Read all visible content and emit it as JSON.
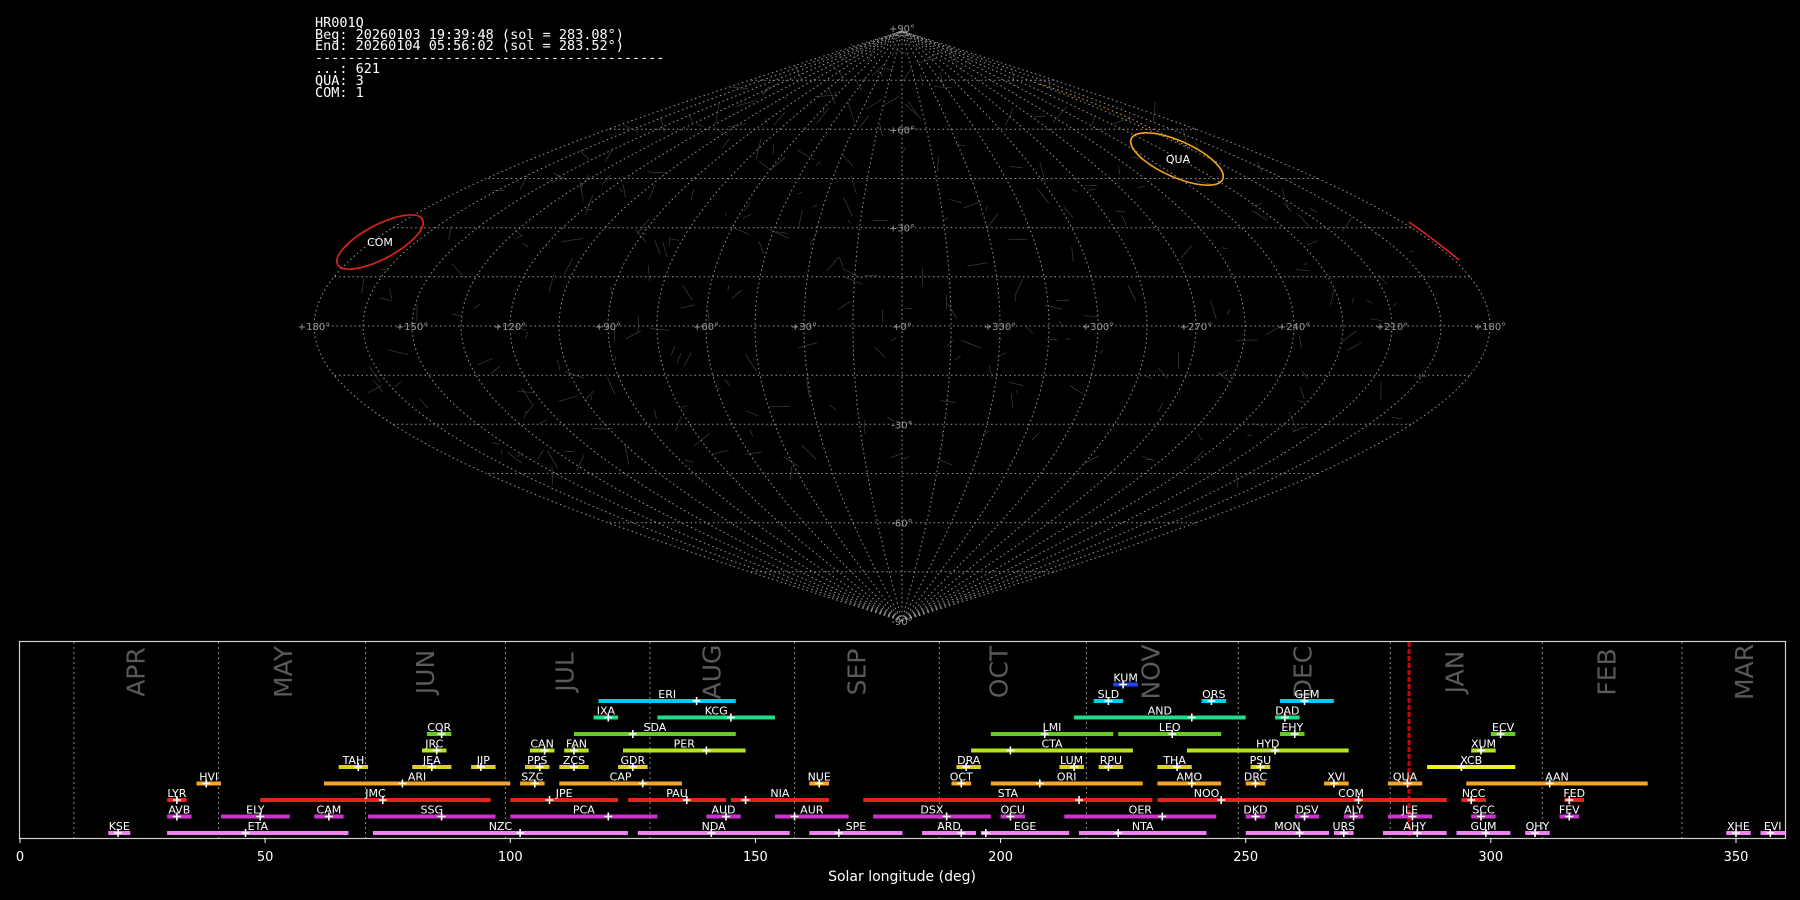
{
  "info": {
    "station": "HR001Q",
    "beg": "Beg: 20260103 19:39:48 (sol = 283.08°)",
    "end": "End: 20260104 05:56:02 (sol = 283.52°)",
    "separator": "-------------------------------------------",
    "counts": [
      "...: 621",
      "QUA: 3",
      "COM: 1"
    ]
  },
  "sky_map": {
    "projection": "sinusoidal",
    "lon_ticks": [
      "+180°",
      "+150°",
      "+120°",
      "+90°",
      "+60°",
      "+30°",
      "+0°",
      "+330°",
      "+300°",
      "+270°",
      "+240°",
      "+210°",
      "+180°"
    ],
    "lat_ticks": [
      "+90°",
      "+60°",
      "+30°",
      "-30°",
      "-60°",
      "-90°"
    ],
    "radiant_circles": [
      {
        "code": "QUA",
        "color": "#f5a623"
      },
      {
        "code": "COM",
        "color": "#e3241b"
      }
    ]
  },
  "chart_data": {
    "type": "timeline",
    "xlabel": "Solar longitude (deg)",
    "xlim": [
      0,
      360
    ],
    "x_ticks": [
      0,
      50,
      100,
      150,
      200,
      250,
      300,
      350
    ],
    "current_sol": 283.3,
    "months": [
      {
        "name": "APR",
        "start": 11,
        "mid": 24
      },
      {
        "name": "MAY",
        "start": 40.5,
        "mid": 54
      },
      {
        "name": "JUN",
        "start": 70.5,
        "mid": 83
      },
      {
        "name": "JUL",
        "start": 99,
        "mid": 111.5
      },
      {
        "name": "AUG",
        "start": 128.5,
        "mid": 141.5
      },
      {
        "name": "SEP",
        "start": 158,
        "mid": 171
      },
      {
        "name": "OCT",
        "start": 187.5,
        "mid": 200
      },
      {
        "name": "NOV",
        "start": 217.5,
        "mid": 231
      },
      {
        "name": "DEC",
        "start": 248.5,
        "mid": 262
      },
      {
        "name": "JAN",
        "start": 279.5,
        "mid": 293
      },
      {
        "name": "FEB",
        "start": 310.5,
        "mid": 324
      },
      {
        "name": "MAR",
        "start": 339,
        "mid": 352
      }
    ],
    "showers": [
      {
        "code": "KSE",
        "start": 18,
        "end": 22.5,
        "peak": 20,
        "row": 0,
        "color": "#ee82ee"
      },
      {
        "code": "ETA",
        "start": 30,
        "end": 67,
        "peak": 46,
        "row": 0,
        "color": "#ee82ee"
      },
      {
        "code": "NZC",
        "start": 72,
        "end": 124,
        "peak": 102,
        "row": 0,
        "color": "#ee82ee"
      },
      {
        "code": "NDA",
        "start": 126,
        "end": 157,
        "peak": 141,
        "row": 0,
        "color": "#ee82ee"
      },
      {
        "code": "SPE",
        "start": 161,
        "end": 180,
        "peak": 167,
        "row": 0,
        "color": "#ee82ee"
      },
      {
        "code": "ARD",
        "start": 184,
        "end": 195,
        "peak": 192,
        "row": 0,
        "color": "#ee82ee"
      },
      {
        "code": "EGE",
        "start": 196,
        "end": 214,
        "peak": 197,
        "row": 0,
        "color": "#ee82ee"
      },
      {
        "code": "NTA",
        "start": 216,
        "end": 242,
        "peak": 224,
        "row": 0,
        "color": "#ee82ee"
      },
      {
        "code": "MON",
        "start": 250,
        "end": 267,
        "peak": 261,
        "row": 0,
        "color": "#ee82ee"
      },
      {
        "code": "URS",
        "start": 268,
        "end": 272,
        "peak": 270,
        "row": 0,
        "color": "#ee82ee"
      },
      {
        "code": "AHY",
        "start": 278,
        "end": 291,
        "peak": 285,
        "row": 0,
        "color": "#ee82ee"
      },
      {
        "code": "GUM",
        "start": 293,
        "end": 304,
        "peak": 299,
        "row": 0,
        "color": "#ee82ee"
      },
      {
        "code": "OHY",
        "start": 307,
        "end": 312,
        "peak": 309,
        "row": 0,
        "color": "#ee82ee"
      },
      {
        "code": "XHE",
        "start": 348,
        "end": 353,
        "peak": 350,
        "row": 0,
        "color": "#ee82ee"
      },
      {
        "code": "EVI",
        "start": 355,
        "end": 360,
        "peak": 357,
        "row": 0,
        "color": "#ee82ee"
      },
      {
        "code": "AVB",
        "start": 30,
        "end": 35,
        "peak": 32,
        "row": 1,
        "color": "#cc33cc"
      },
      {
        "code": "ELY",
        "start": 41,
        "end": 55,
        "peak": 49,
        "row": 1,
        "color": "#cc33cc"
      },
      {
        "code": "CAM",
        "start": 60,
        "end": 66,
        "peak": 63,
        "row": 1,
        "color": "#cc33cc"
      },
      {
        "code": "SSG",
        "start": 71,
        "end": 97,
        "peak": 86,
        "row": 1,
        "color": "#cc33cc"
      },
      {
        "code": "PCA",
        "start": 100,
        "end": 130,
        "peak": 120,
        "row": 1,
        "color": "#cc33cc"
      },
      {
        "code": "AUD",
        "start": 140,
        "end": 147,
        "peak": 144,
        "row": 1,
        "color": "#cc33cc"
      },
      {
        "code": "AUR",
        "start": 154,
        "end": 169,
        "peak": 158,
        "row": 1,
        "color": "#cc33cc"
      },
      {
        "code": "DSX",
        "start": 174,
        "end": 198,
        "peak": 189,
        "row": 1,
        "color": "#cc33cc"
      },
      {
        "code": "OCU",
        "start": 200,
        "end": 205,
        "peak": 202,
        "row": 1,
        "color": "#cc33cc"
      },
      {
        "code": "OER",
        "start": 213,
        "end": 244,
        "peak": 233,
        "row": 1,
        "color": "#cc33cc"
      },
      {
        "code": "DKD",
        "start": 250,
        "end": 254,
        "peak": 252,
        "row": 1,
        "color": "#cc33cc"
      },
      {
        "code": "DSV",
        "start": 260,
        "end": 265,
        "peak": 262,
        "row": 1,
        "color": "#cc33cc"
      },
      {
        "code": "ALY",
        "start": 270,
        "end": 274,
        "peak": 272,
        "row": 1,
        "color": "#cc33cc"
      },
      {
        "code": "JLE",
        "start": 279,
        "end": 288,
        "peak": 284,
        "row": 1,
        "color": "#cc33cc"
      },
      {
        "code": "SCC",
        "start": 296,
        "end": 301,
        "peak": 298,
        "row": 1,
        "color": "#cc33cc"
      },
      {
        "code": "FEV",
        "start": 314,
        "end": 318,
        "peak": 316,
        "row": 1,
        "color": "#cc33cc"
      },
      {
        "code": "LYR",
        "start": 30,
        "end": 34,
        "peak": 32,
        "row": 2,
        "color": "#e3241b"
      },
      {
        "code": "JMC",
        "start": 49,
        "end": 96,
        "peak": 74,
        "row": 2,
        "color": "#e3241b"
      },
      {
        "code": "JPE",
        "start": 100,
        "end": 122,
        "peak": 108,
        "row": 2,
        "color": "#e3241b"
      },
      {
        "code": "PAU",
        "start": 124,
        "end": 144,
        "peak": 136,
        "row": 2,
        "color": "#e3241b"
      },
      {
        "code": "NIA",
        "start": 145,
        "end": 165,
        "peak": 148,
        "row": 2,
        "color": "#e3241b"
      },
      {
        "code": "STA",
        "start": 172,
        "end": 231,
        "peak": 216,
        "row": 2,
        "color": "#e3241b"
      },
      {
        "code": "NOO",
        "start": 232,
        "end": 252,
        "peak": 245,
        "row": 2,
        "color": "#e3241b"
      },
      {
        "code": "COM",
        "start": 252,
        "end": 291,
        "peak": 273,
        "row": 2,
        "color": "#e3241b"
      },
      {
        "code": "NCC",
        "start": 294,
        "end": 299,
        "peak": 296,
        "row": 2,
        "color": "#e3241b"
      },
      {
        "code": "FED",
        "start": 315,
        "end": 319,
        "peak": 316,
        "row": 2,
        "color": "#e3241b"
      },
      {
        "code": "HVI",
        "start": 36,
        "end": 41,
        "peak": 38,
        "row": 3,
        "color": "#f5a623"
      },
      {
        "code": "ARI",
        "start": 62,
        "end": 100,
        "peak": 78,
        "row": 3,
        "color": "#f5a623"
      },
      {
        "code": "SZC",
        "start": 102,
        "end": 107,
        "peak": 105,
        "row": 3,
        "color": "#f5a623"
      },
      {
        "code": "CAP",
        "start": 110,
        "end": 135,
        "peak": 127,
        "row": 3,
        "color": "#f5a623"
      },
      {
        "code": "NUE",
        "start": 161,
        "end": 165,
        "peak": 163,
        "row": 3,
        "color": "#f5a623"
      },
      {
        "code": "OCT",
        "start": 190,
        "end": 194,
        "peak": 192,
        "row": 3,
        "color": "#f5a623"
      },
      {
        "code": "ORI",
        "start": 198,
        "end": 229,
        "peak": 208,
        "row": 3,
        "color": "#f5a623"
      },
      {
        "code": "AMO",
        "start": 232,
        "end": 245,
        "peak": 239,
        "row": 3,
        "color": "#f5a623"
      },
      {
        "code": "DRC",
        "start": 250,
        "end": 254,
        "peak": 252,
        "row": 3,
        "color": "#f5a623"
      },
      {
        "code": "XVI",
        "start": 266,
        "end": 271,
        "peak": 268,
        "row": 3,
        "color": "#f5a623"
      },
      {
        "code": "QUA",
        "start": 279,
        "end": 286,
        "peak": 283,
        "row": 3,
        "color": "#f5a623"
      },
      {
        "code": "AAN",
        "start": 295,
        "end": 332,
        "peak": 312,
        "row": 3,
        "color": "#f5a623"
      },
      {
        "code": "TAH",
        "start": 65,
        "end": 71,
        "peak": 69,
        "row": 4,
        "color": "#ddcc22"
      },
      {
        "code": "JEA",
        "start": 80,
        "end": 88,
        "peak": 84,
        "row": 4,
        "color": "#ddcc22"
      },
      {
        "code": "JIP",
        "start": 92,
        "end": 97,
        "peak": 94,
        "row": 4,
        "color": "#ddcc22"
      },
      {
        "code": "PPS",
        "start": 103,
        "end": 108,
        "peak": 106,
        "row": 4,
        "color": "#ddcc22"
      },
      {
        "code": "ZCS",
        "start": 110,
        "end": 116,
        "peak": 113,
        "row": 4,
        "color": "#ddcc22"
      },
      {
        "code": "GDR",
        "start": 122,
        "end": 128,
        "peak": 125,
        "row": 4,
        "color": "#ddcc22"
      },
      {
        "code": "DRA",
        "start": 191,
        "end": 196,
        "peak": 193,
        "row": 4,
        "color": "#ddcc22"
      },
      {
        "code": "LUM",
        "start": 212,
        "end": 217,
        "peak": 215,
        "row": 4,
        "color": "#ddcc22"
      },
      {
        "code": "RPU",
        "start": 220,
        "end": 225,
        "peak": 222,
        "row": 4,
        "color": "#ddcc22"
      },
      {
        "code": "THA",
        "start": 232,
        "end": 239,
        "peak": 236,
        "row": 4,
        "color": "#ddcc22"
      },
      {
        "code": "PSU",
        "start": 251,
        "end": 255,
        "peak": 253,
        "row": 4,
        "color": "#ddcc22"
      },
      {
        "code": "XCB",
        "start": 287,
        "end": 305,
        "peak": 294,
        "row": 4,
        "color": "#f0f020"
      },
      {
        "code": "JRC",
        "start": 82,
        "end": 87,
        "peak": 85,
        "row": 5,
        "color": "#b5e61d"
      },
      {
        "code": "CAN",
        "start": 104,
        "end": 109,
        "peak": 107,
        "row": 5,
        "color": "#b5e61d"
      },
      {
        "code": "FAN",
        "start": 111,
        "end": 116,
        "peak": 113,
        "row": 5,
        "color": "#b5e61d"
      },
      {
        "code": "PER",
        "start": 123,
        "end": 148,
        "peak": 140,
        "row": 5,
        "color": "#b5e61d"
      },
      {
        "code": "CTA",
        "start": 194,
        "end": 227,
        "peak": 202,
        "row": 5,
        "color": "#b5e61d"
      },
      {
        "code": "HYD",
        "start": 238,
        "end": 271,
        "peak": 256,
        "row": 5,
        "color": "#b5e61d"
      },
      {
        "code": "XUM",
        "start": 296,
        "end": 301,
        "peak": 298,
        "row": 5,
        "color": "#b5e61d"
      },
      {
        "code": "COR",
        "start": 83,
        "end": 88,
        "peak": 86,
        "row": 6,
        "color": "#66cc22"
      },
      {
        "code": "SDA",
        "start": 113,
        "end": 146,
        "peak": 125,
        "row": 6,
        "color": "#66cc22"
      },
      {
        "code": "LMI",
        "start": 198,
        "end": 223,
        "peak": 209,
        "row": 6,
        "color": "#66cc22"
      },
      {
        "code": "LEO",
        "start": 224,
        "end": 245,
        "peak": 235,
        "row": 6,
        "color": "#66cc22"
      },
      {
        "code": "EHY",
        "start": 257,
        "end": 262,
        "peak": 260,
        "row": 6,
        "color": "#66cc22"
      },
      {
        "code": "ECV",
        "start": 300,
        "end": 305,
        "peak": 302,
        "row": 6,
        "color": "#66cc22"
      },
      {
        "code": "IXA",
        "start": 117,
        "end": 122,
        "peak": 120,
        "row": 7,
        "color": "#22dd88"
      },
      {
        "code": "KCG",
        "start": 130,
        "end": 154,
        "peak": 145,
        "row": 7,
        "color": "#22dd88"
      },
      {
        "code": "AND",
        "start": 215,
        "end": 250,
        "peak": 239,
        "row": 7,
        "color": "#22dd88"
      },
      {
        "code": "DAD",
        "start": 256,
        "end": 261,
        "peak": 258,
        "row": 7,
        "color": "#22dd88"
      },
      {
        "code": "ERI",
        "start": 118,
        "end": 146,
        "peak": 138,
        "row": 8,
        "color": "#00ccee"
      },
      {
        "code": "SLD",
        "start": 219,
        "end": 225,
        "peak": 222,
        "row": 8,
        "color": "#00ccee"
      },
      {
        "code": "ORS",
        "start": 241,
        "end": 246,
        "peak": 243,
        "row": 8,
        "color": "#00ccee"
      },
      {
        "code": "GEM",
        "start": 257,
        "end": 268,
        "peak": 262,
        "row": 8,
        "color": "#00ccee"
      },
      {
        "code": "KUM",
        "start": 223,
        "end": 228,
        "peak": 225,
        "row": 9,
        "color": "#2244ee"
      }
    ]
  }
}
